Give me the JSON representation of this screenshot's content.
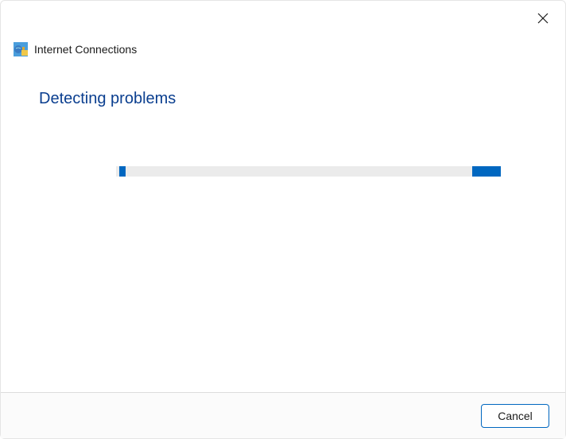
{
  "window": {
    "title": "Internet Connections"
  },
  "content": {
    "heading": "Detecting problems"
  },
  "footer": {
    "cancel_label": "Cancel"
  },
  "icons": {
    "close": "close-icon",
    "app": "internet-connections-icon"
  },
  "colors": {
    "accent": "#0067c0",
    "heading": "#0a3e8f"
  }
}
